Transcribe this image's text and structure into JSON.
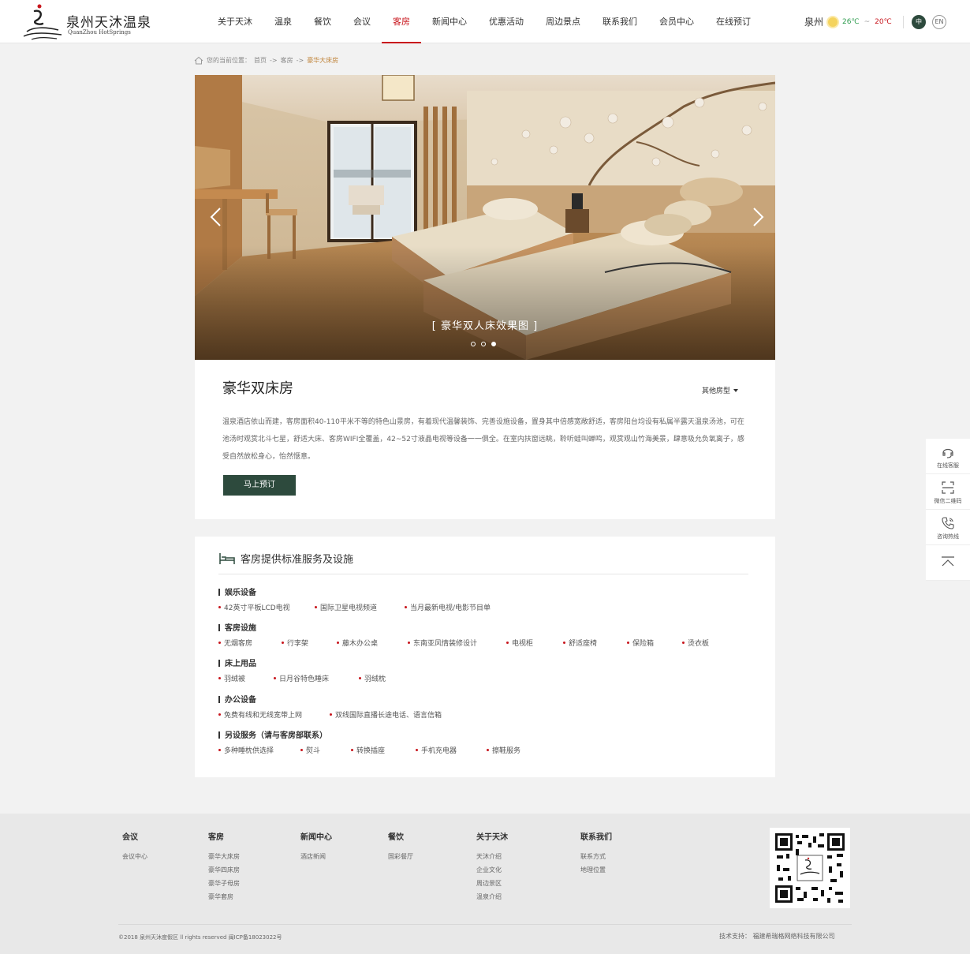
{
  "brand": {
    "name_cn": "泉州天沐温泉",
    "name_en": "QuanZhou  HotSprings"
  },
  "nav": {
    "items": [
      {
        "label": "关于天沐"
      },
      {
        "label": "温泉"
      },
      {
        "label": "餐饮"
      },
      {
        "label": "会议"
      },
      {
        "label": "客房",
        "active": true
      },
      {
        "label": "新闻中心"
      },
      {
        "label": "优惠活动"
      },
      {
        "label": "周边景点"
      },
      {
        "label": "联系我们"
      },
      {
        "label": "会员中心"
      },
      {
        "label": "在线预订"
      }
    ]
  },
  "weather": {
    "city": "泉州",
    "icon": "sun-icon",
    "low": "26℃",
    "separator": "~",
    "high": "20℃"
  },
  "lang": {
    "cn": "中",
    "en": "EN"
  },
  "breadcrumb": {
    "prefix": "您的当前位置：",
    "home": "首页",
    "sep1": "->",
    "section": "客房",
    "sep2": "->",
    "current": "豪华大床房"
  },
  "banner": {
    "caption": "[  豪华双人床效果图  ]",
    "slides_total": 3,
    "active_slide": 3
  },
  "room": {
    "title": "豪华双床房",
    "other_types": "其他房型",
    "description": "温泉酒店依山而建，客房面积40-110平米不等的特色山景房，有着现代温馨装饰、完善设施设备，置身其中倍感宽敞舒适，客房阳台均设有私属半露天温泉汤池，可在池汤时观赏北斗七星，舒适大床、客房WIFI全覆盖，42~52寸液晶电视等设备一一俱全。在室内扶窗远眺，聆听蛙叫蝉鸣，观赏观山竹海美景，肆意吸允负氧离子，感受自然放松身心，怡然惬意。",
    "book_label": "马上预订"
  },
  "services": {
    "title": "客房提供标准服务及设施",
    "groups": [
      {
        "title": "娱乐设备",
        "items": [
          "42英寸平板LCD电视",
          "国际卫星电视频道",
          "当月最新电视/电影节目单"
        ]
      },
      {
        "title": "客房设施",
        "items": [
          "无烟客房",
          "行李架",
          "藤木办公桌",
          "东南亚风情装修设计",
          "电视柜",
          "舒适座椅",
          "保险箱",
          "烫衣板"
        ]
      },
      {
        "title": "床上用品",
        "items": [
          "羽绒被",
          "日月谷特色睡床",
          "羽绒枕"
        ]
      },
      {
        "title": "办公设备",
        "items": [
          "免费有线和无线宽带上网",
          "双线国际直播长途电话、语言信箱"
        ]
      },
      {
        "title": "另设服务（请与客房部联系）",
        "items": [
          "多种睡枕供选择",
          "熨斗",
          "转换插座",
          "手机充电器",
          "擦鞋服务"
        ]
      }
    ]
  },
  "side_tools": {
    "service": "在线客服",
    "wechat": "微信二维码",
    "hotline": "咨询热线"
  },
  "footer": {
    "columns": [
      {
        "title": "会议",
        "links": [
          "会议中心"
        ]
      },
      {
        "title": "客房",
        "links": [
          "豪华大床房",
          "豪华四床房",
          "豪华子母房",
          "豪华套房"
        ]
      },
      {
        "title": "新闻中心",
        "links": [
          "酒店新闻"
        ]
      },
      {
        "title": "餐饮",
        "links": [
          "国彩餐厅"
        ]
      },
      {
        "title": "关于天沐",
        "links": [
          "天沐介绍",
          "企业文化",
          "周边景区",
          "温泉介绍"
        ]
      },
      {
        "title": "联系我们",
        "links": [
          "联系方式",
          "地理位置"
        ]
      }
    ],
    "copyright": "©2018 泉州天沐度假区 ll rights reserved 闽ICP备18023022号",
    "tech_label": "技术支持：",
    "tech_company": "福建希瑞格网络科技有限公司"
  }
}
